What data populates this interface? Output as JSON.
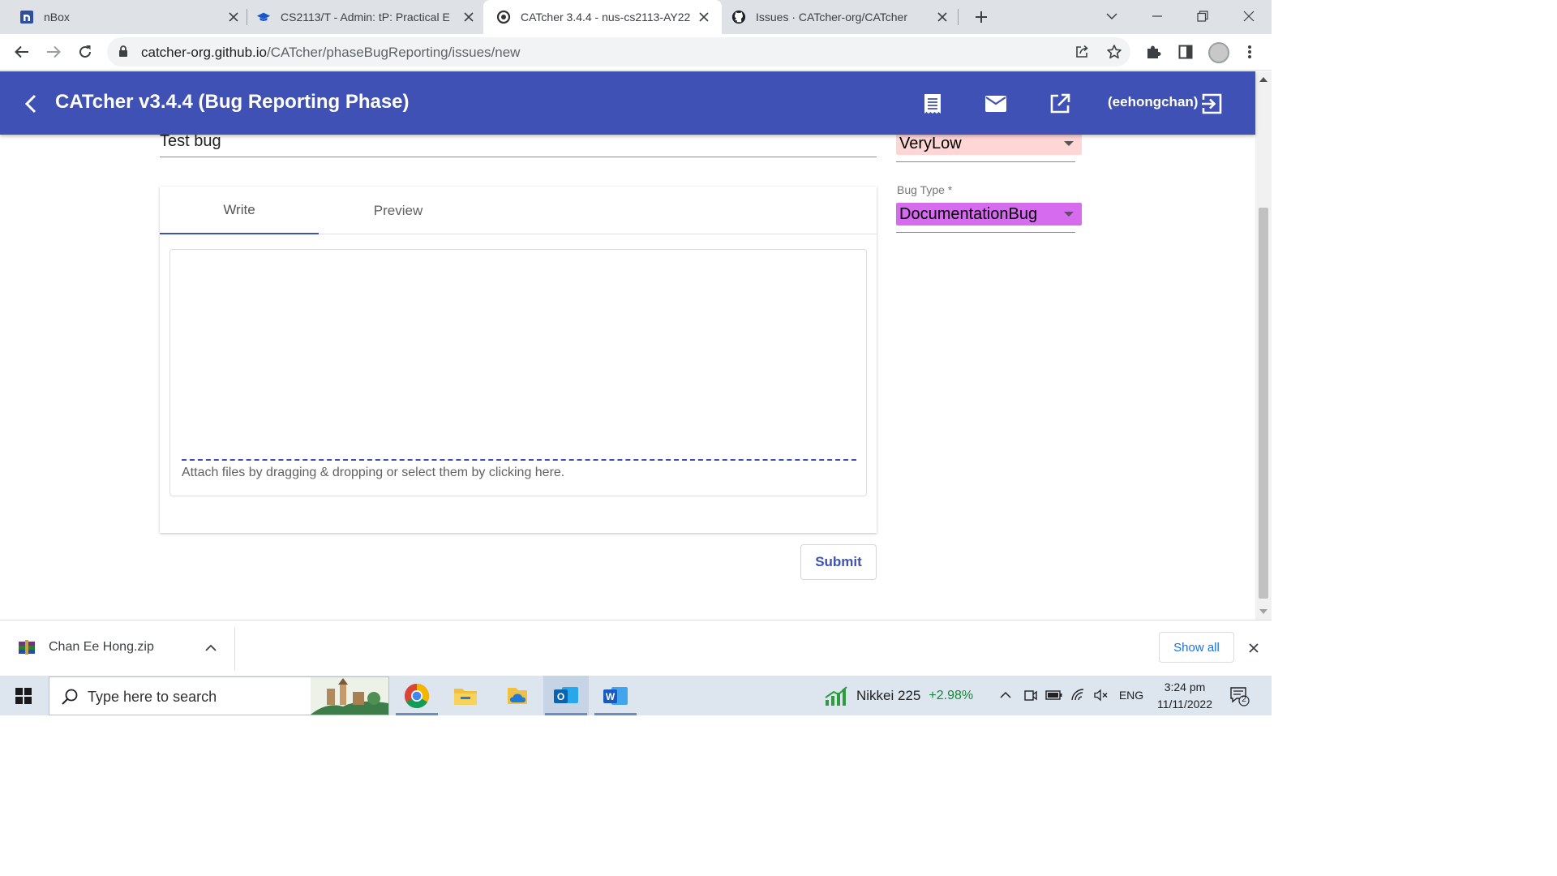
{
  "browser": {
    "tabs": [
      {
        "title": "nBox",
        "active": false
      },
      {
        "title": "CS2113/T - Admin: tP: Practical E",
        "active": false
      },
      {
        "title": "CATcher 3.4.4 - nus-cs2113-AY22",
        "active": true
      },
      {
        "title": "Issues · CATcher-org/CATcher",
        "active": false
      }
    ],
    "url_host": "catcher-org.github.io",
    "url_path": "/CATcher/phaseBugReporting/issues/new"
  },
  "app": {
    "title": "CATcher v3.4.4  (Bug Reporting Phase)",
    "username": "(eehongchan)",
    "colors": {
      "primary": "#3f51b5",
      "severity_bg": "#ffd6d6",
      "bug_type_bg": "#d66bf0"
    }
  },
  "form": {
    "title_value": "Test bug",
    "severity_value": "VeryLow",
    "bug_type_label": "Bug Type *",
    "bug_type_value": "DocumentationBug",
    "tab_write": "Write",
    "tab_preview": "Preview",
    "attach_text": "Attach files by dragging & dropping or select them by clicking here.",
    "submit_label": "Submit"
  },
  "downloads": {
    "file_name": "Chan Ee Hong.zip",
    "show_all": "Show all"
  },
  "taskbar": {
    "search_placeholder": "Type here to search",
    "stock_name": "Nikkei 225",
    "stock_change": "+2.98%",
    "language": "ENG",
    "time": "3:24 pm",
    "date": "11/11/2022",
    "notification_count": "2"
  }
}
